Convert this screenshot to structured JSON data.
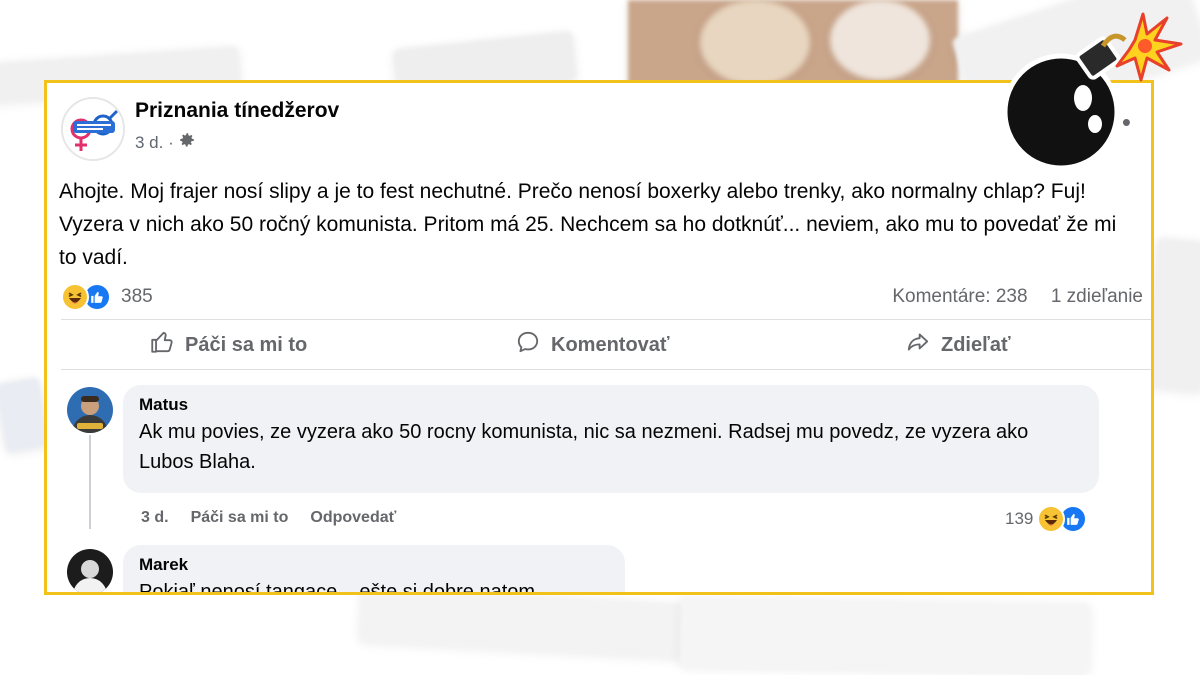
{
  "post": {
    "page_name": "Priznania tínedžerov",
    "time": "3 d. ·",
    "text": "Ahojte. Moj frajer nosí slipy a je to fest nechutné. Prečo nenosí boxerky alebo trenky, ako normalny chlap? Fuj! Vyzera v nich ako 50 ročný komunista. Pritom má 25. Nechcem sa ho dotknúť... neviem, ako mu to povedať že mi to vadí.",
    "reaction_count": "385",
    "comments_label": "Komentáre: 238",
    "shares_label": "1 zdieľanie"
  },
  "actions": {
    "like": "Páči sa mi to",
    "comment": "Komentovať",
    "share": "Zdieľať"
  },
  "comments": [
    {
      "author": "Matus",
      "text": "Ak mu povies, ze vyzera ako 50 rocny komunista, nic sa nezmeni. Radsej mu povedz, ze vyzera ako Lubos Blaha.",
      "time": "3 d.",
      "like": "Páči sa mi to",
      "reply": "Odpovedať",
      "reaction_count": "139"
    },
    {
      "author": "Marek",
      "text": "Pokiaľ nenosí tangace... ešte si dobre natom"
    }
  ],
  "icons": {
    "settings": "gear-icon",
    "more": "more-dots-icon",
    "like": "thumbs-up-icon",
    "comment": "speech-bubble-icon",
    "share": "share-arrow-icon",
    "reactions": [
      "haha-emoji-icon",
      "like-reaction-icon"
    ],
    "sticker": "bomb-icon"
  },
  "colors": {
    "frame_border": "#f2c21b",
    "facebook_blue": "#1877f2",
    "muted_text": "#65676b",
    "bubble_bg": "#f0f2f5"
  }
}
